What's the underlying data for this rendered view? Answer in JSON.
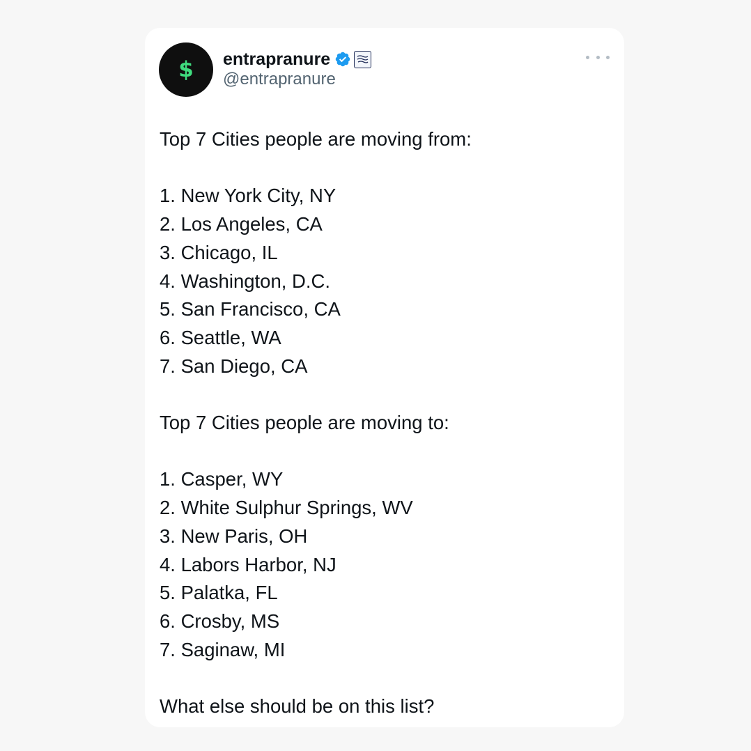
{
  "tweet": {
    "display_name": "entrapranure",
    "handle": "@entrapranure",
    "avatar_symbol": "$",
    "avatar_bg": "#0f0f0f",
    "avatar_fg": "#3fdc7e",
    "verified_color": "#1d9bf0",
    "more_icon": "more-horizontal-icon",
    "heading_from": "Top 7 Cities people are moving from:",
    "from_list": [
      "1. New York City, NY",
      "2. Los Angeles, CA",
      "3. Chicago, IL",
      "4. Washington, D.C.",
      "5. San Francisco, CA",
      "6. Seattle, WA",
      "7. San Diego, CA"
    ],
    "heading_to": "Top 7 Cities people are moving to:",
    "to_list": [
      "1. Casper, WY",
      "2. White Sulphur Springs, WV",
      "3. New Paris, OH",
      "4. Labors Harbor, NJ",
      "5. Palatka, FL",
      "6. Crosby, MS",
      "7. Saginaw, MI"
    ],
    "closing": "What else should be on this list?"
  }
}
